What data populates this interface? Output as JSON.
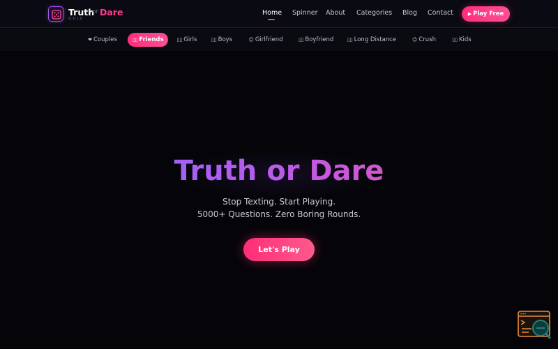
{
  "logo": {
    "truth": "Truth",
    "or": "or",
    "dare": "Dare",
    "sub": "QUIZ"
  },
  "nav": {
    "items": [
      {
        "label": "Home",
        "active": true
      },
      {
        "label": "Spinner",
        "active": false
      },
      {
        "label": "About",
        "active": false
      },
      {
        "label": "Categories",
        "active": false
      },
      {
        "label": "Blog",
        "active": false
      },
      {
        "label": "Contact",
        "active": false
      }
    ],
    "cta_label": "Play Free"
  },
  "categories": [
    {
      "label": "Couples",
      "icon": "heart-icon",
      "glyph": "❤",
      "active": false
    },
    {
      "label": "Friends",
      "icon": "friends-icon",
      "glyph": "▯▯",
      "active": true
    },
    {
      "label": "Girls",
      "icon": "girls-icon",
      "glyph": "▯▯",
      "active": false
    },
    {
      "label": "Boys",
      "icon": "boys-icon",
      "glyph": "▯▯",
      "active": false
    },
    {
      "label": "Girlfriend",
      "icon": "smile-icon",
      "glyph": "☺",
      "active": false
    },
    {
      "label": "Boyfriend",
      "icon": "boyfriend-icon",
      "glyph": "▯▯",
      "active": false
    },
    {
      "label": "Long Distance",
      "icon": "long-distance-icon",
      "glyph": "▯▯",
      "active": false
    },
    {
      "label": "Crush",
      "icon": "blush-icon",
      "glyph": "☺",
      "active": false
    },
    {
      "label": "Kids",
      "icon": "kids-icon",
      "glyph": "▯▯",
      "active": false
    }
  ],
  "hero": {
    "title": "Truth or Dare",
    "subtitle_line1": "Stop Texting. Start Playing.",
    "subtitle_line2": "5000+ Questions. Zero Boring Rounds.",
    "cta_label": "Let's Play"
  },
  "colors": {
    "accent_pink": "#ff2d7a",
    "accent_purple": "#7b6cff",
    "background": "#050509"
  }
}
